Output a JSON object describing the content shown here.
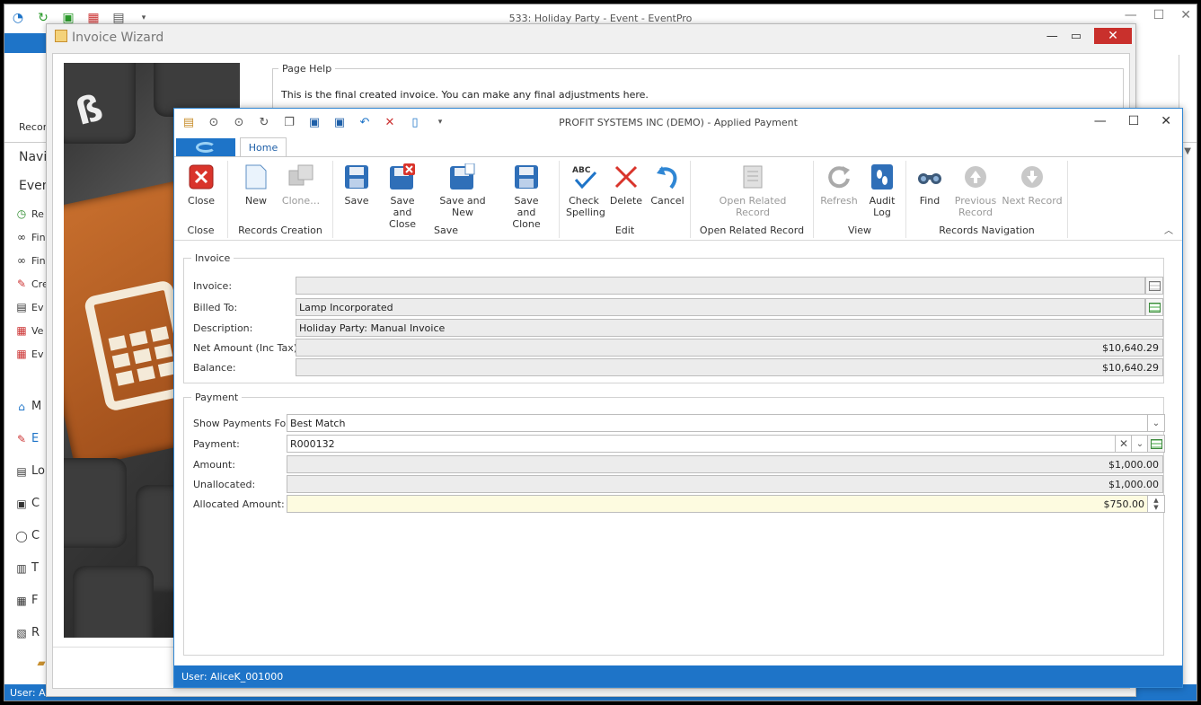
{
  "main_window": {
    "title": "533: Holiday Party - Event - EventPro",
    "ribbon_fragment": "Recor",
    "nav_heading_1": "Navig",
    "nav_heading_2": "Event",
    "nav_items_top": [
      "Re",
      "Fin",
      "Fin",
      "Cre",
      "Ev",
      "Ve",
      "Ev"
    ],
    "nav_items_bottom": [
      "M",
      "E",
      "Lo",
      "C",
      "C",
      "T",
      "F",
      "R"
    ],
    "status": "User: Al"
  },
  "wizard": {
    "title": "Invoice Wizard",
    "page_help_legend": "Page Help",
    "page_help_text": "This is the final created invoice.  You can make any final adjustments here."
  },
  "dialog": {
    "title": "PROFIT SYSTEMS INC (DEMO) - Applied Payment",
    "home_tab": "Home",
    "ribbon": {
      "close": {
        "group": "Close",
        "buttons": [
          "Close"
        ]
      },
      "records_creation": {
        "group": "Records Creation",
        "buttons": [
          "New",
          "Clone…"
        ]
      },
      "save": {
        "group": "Save",
        "buttons": [
          "Save",
          "Save and Close",
          "Save and New",
          "Save and Clone"
        ]
      },
      "edit": {
        "group": "Edit",
        "buttons": [
          "Check Spelling",
          "Delete",
          "Cancel"
        ]
      },
      "open_related": {
        "group": "Open Related Record",
        "buttons": [
          "Open Related Record"
        ]
      },
      "view": {
        "group": "View",
        "buttons": [
          "Refresh",
          "Audit Log"
        ]
      },
      "records_navigation": {
        "group": "Records Navigation",
        "buttons": [
          "Find",
          "Previous Record",
          "Next Record"
        ]
      }
    },
    "invoice_section": {
      "legend": "Invoice",
      "invoice_label": "Invoice:",
      "invoice_value": "",
      "billed_to_label": "Billed To:",
      "billed_to_value": "Lamp Incorporated",
      "description_label": "Description:",
      "description_value": "Holiday Party: Manual Invoice",
      "net_amount_label": "Net Amount (Inc Tax):",
      "net_amount_value": "$10,640.29",
      "balance_label": "Balance:",
      "balance_value": "$10,640.29"
    },
    "payment_section": {
      "legend": "Payment",
      "show_for_label": "Show Payments For:",
      "show_for_value": "Best Match",
      "payment_label": "Payment:",
      "payment_value": "R000132",
      "amount_label": "Amount:",
      "amount_value": "$1,000.00",
      "unallocated_label": "Unallocated:",
      "unallocated_value": "$1,000.00",
      "allocated_label": "Allocated Amount:",
      "allocated_value": "$750.00"
    },
    "status": "User: AliceK_001000"
  },
  "colors": {
    "accent": "#1e74c8",
    "close_red": "#c9302c",
    "field_yellow": "#fdfbe0"
  }
}
